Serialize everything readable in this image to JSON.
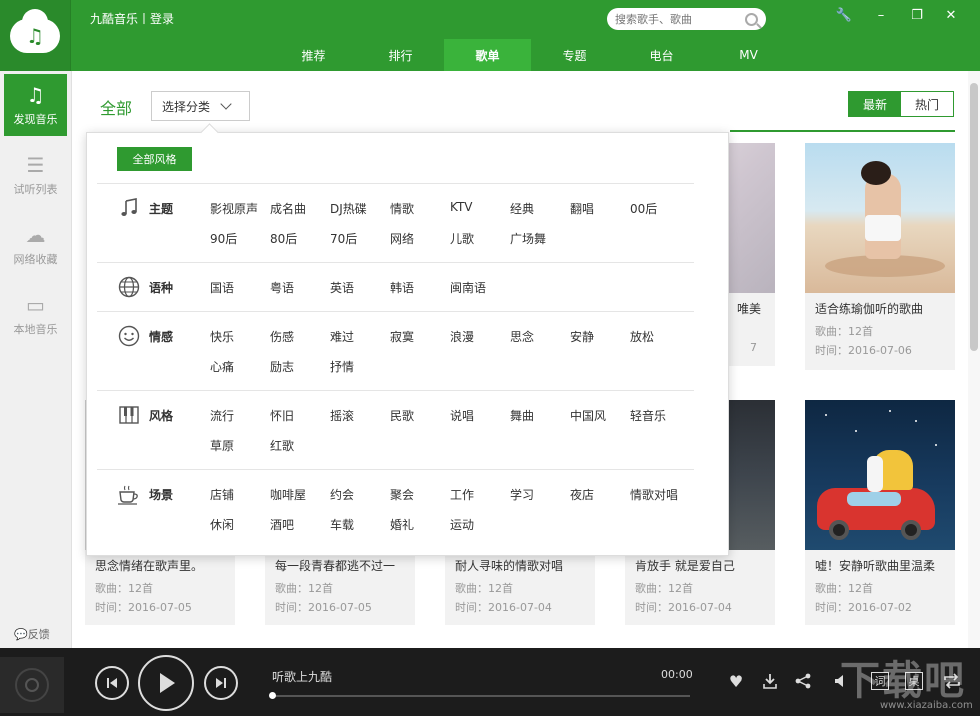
{
  "app": {
    "title": "九酷音乐丨登录"
  },
  "search": {
    "placeholder": "搜索歌手、歌曲"
  },
  "nav": [
    "推荐",
    "排行",
    "歌单",
    "专题",
    "电台",
    "MV"
  ],
  "sidebar": {
    "items": [
      {
        "label": "发现音乐",
        "icon": "music-note-icon"
      },
      {
        "label": "试听列表",
        "icon": "list-icon"
      },
      {
        "label": "网络收藏",
        "icon": "cloud-icon"
      },
      {
        "label": "本地音乐",
        "icon": "monitor-icon"
      }
    ],
    "feedback": "反馈"
  },
  "main": {
    "all_label": "全部",
    "select_category": "选择分类",
    "sort": [
      "最新",
      "热门"
    ]
  },
  "dropdown": {
    "all_styles": "全部风格",
    "rows": [
      {
        "label": "主题",
        "icon": "music-note-icon",
        "tags": [
          "影视原声",
          "成名曲",
          "DJ热碟",
          "情歌",
          "KTV",
          "经典",
          "翻唱",
          "00后",
          "90后",
          "80后",
          "70后",
          "网络",
          "儿歌",
          "广场舞"
        ]
      },
      {
        "label": "语种",
        "icon": "globe-icon",
        "tags": [
          "国语",
          "粤语",
          "英语",
          "韩语",
          "闽南语"
        ]
      },
      {
        "label": "情感",
        "icon": "smiley-icon",
        "tags": [
          "快乐",
          "伤感",
          "难过",
          "寂寞",
          "浪漫",
          "思念",
          "安静",
          "放松",
          "心痛",
          "励志",
          "抒情"
        ]
      },
      {
        "label": "风格",
        "icon": "piano-icon",
        "tags": [
          "流行",
          "怀旧",
          "摇滚",
          "民歌",
          "说唱",
          "舞曲",
          "中国风",
          "轻音乐",
          "草原",
          "红歌"
        ]
      },
      {
        "label": "场景",
        "icon": "coffee-cup-icon",
        "tags": [
          "店铺",
          "咖啡屋",
          "约会",
          "聚会",
          "工作",
          "学习",
          "夜店",
          "情歌对唱",
          "休闲",
          "酒吧",
          "车载",
          "婚礼",
          "运动"
        ]
      }
    ]
  },
  "cards": {
    "top_partial": {
      "title_fragment": "唯美",
      "time_fragment": "7"
    },
    "top_right": {
      "title": "适合练瑜伽听的歌曲",
      "songs": "歌曲：12首",
      "time": "时间：2016-07-06"
    },
    "bottom": [
      {
        "title": "思念情绪在歌声里。",
        "songs": "歌曲：12首",
        "time": "时间：2016-07-05"
      },
      {
        "title": "每一段青春都逃不过一",
        "songs": "歌曲：12首",
        "time": "时间：2016-07-05"
      },
      {
        "title": "耐人寻味的情歌对唱",
        "songs": "歌曲：12首",
        "time": "时间：2016-07-04"
      },
      {
        "title": "肯放手 就是爱自己",
        "songs": "歌曲：12首",
        "time": "时间：2016-07-04"
      },
      {
        "title": "嘘！安静听歌曲里温柔",
        "songs": "歌曲：12首",
        "time": "时间：2016-07-02"
      }
    ]
  },
  "player": {
    "song": "听歌上九酷",
    "time": "00:00",
    "progress": 0,
    "lyric_btn": "词",
    "desktop_btn": "桌"
  },
  "watermark": {
    "text": "下载吧",
    "url": "www.xiazaiba.com"
  }
}
